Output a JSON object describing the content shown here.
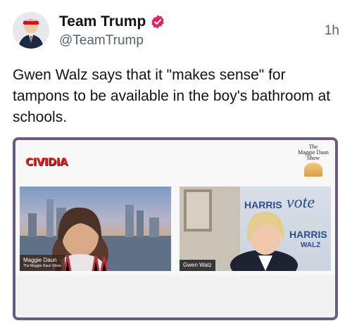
{
  "author": {
    "display_name": "Team Trump",
    "handle": "@TeamTrump",
    "time": "1h"
  },
  "tweet": {
    "text": "Gwen Walz says that it \"makes sense\" for tampons to be available in the boy's bathroom at schools."
  },
  "media": {
    "logo_text": "CIVIDIA",
    "show_badge": [
      "The",
      "Maggie Daun",
      "Show"
    ],
    "left_panel": {
      "nameplate": "Maggie Daun",
      "nameplate_sub": "The Maggie Daun Show"
    },
    "right_panel": {
      "nameplate": "Gwen Walz",
      "sign_text_1": "HARRIS",
      "sign_vote": "vote",
      "sign_text_2": "HARRIS",
      "sign_text_3": "WALZ"
    }
  },
  "colors": {
    "verified_badge": "#e0245e",
    "frame_border": "#6c5a82",
    "sign_blue": "#2e4e8a"
  },
  "icons": [
    "verified-badge-icon"
  ]
}
